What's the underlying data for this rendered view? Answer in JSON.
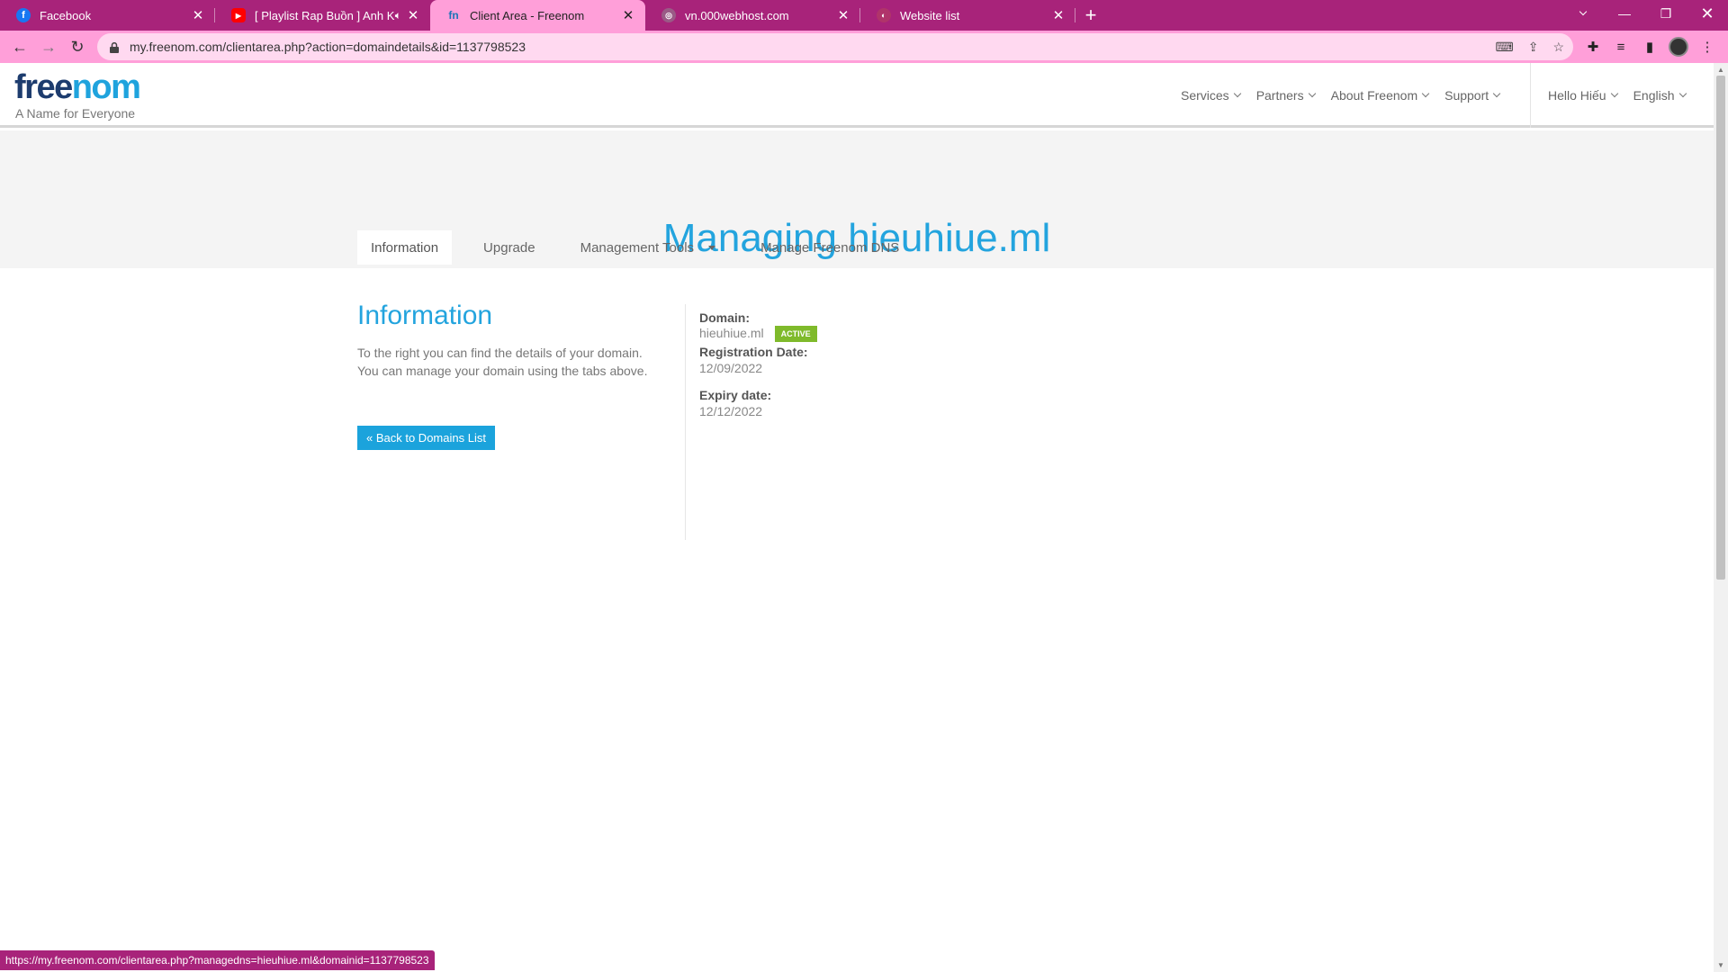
{
  "browser": {
    "tabs": [
      {
        "title": "Facebook",
        "icon": "facebook-icon"
      },
      {
        "title": "[ Playlist Rap Buồn ] Anh Khô",
        "icon": "youtube-icon"
      },
      {
        "title": "Client Area - Freenom",
        "icon": "freenom-icon"
      },
      {
        "title": "vn.000webhost.com",
        "icon": "globe-icon"
      },
      {
        "title": "Website list",
        "icon": "webhost-icon"
      }
    ],
    "active_tab_index": 2,
    "url": "my.freenom.com/clientarea.php?action=domaindetails&id=1137798523",
    "status_url": "https://my.freenom.com/clientarea.php?managedns=hieuhiue.ml&domainid=1137798523",
    "colors": {
      "chrome": "#a8237a",
      "toolbar": "#ff9fd9"
    }
  },
  "site": {
    "logo": {
      "free": "free",
      "nom": "nom",
      "tagline": "A Name for Everyone"
    },
    "nav": [
      "Services",
      "Partners",
      "About Freenom",
      "Support"
    ],
    "user": "Hello Hiếu",
    "language": "English"
  },
  "page": {
    "title": "Managing hieuhiue.ml",
    "tabs": [
      "Information",
      "Upgrade",
      "Management Tools",
      "Manage Freenom DNS"
    ],
    "info": {
      "heading": "Information",
      "line1": "To the right you can find the details of your domain.",
      "line2": "You can manage your domain using the tabs above.",
      "back_button": "« Back to Domains List"
    },
    "details": {
      "domain_label": "Domain:",
      "domain_value": "hieuhiue.ml",
      "status": "ACTIVE",
      "reg_label": "Registration Date:",
      "reg_value": "12/09/2022",
      "exp_label": "Expiry date:",
      "exp_value": "12/12/2022"
    },
    "colors": {
      "accent": "#23a4de",
      "status_active": "#7fba2b"
    }
  }
}
